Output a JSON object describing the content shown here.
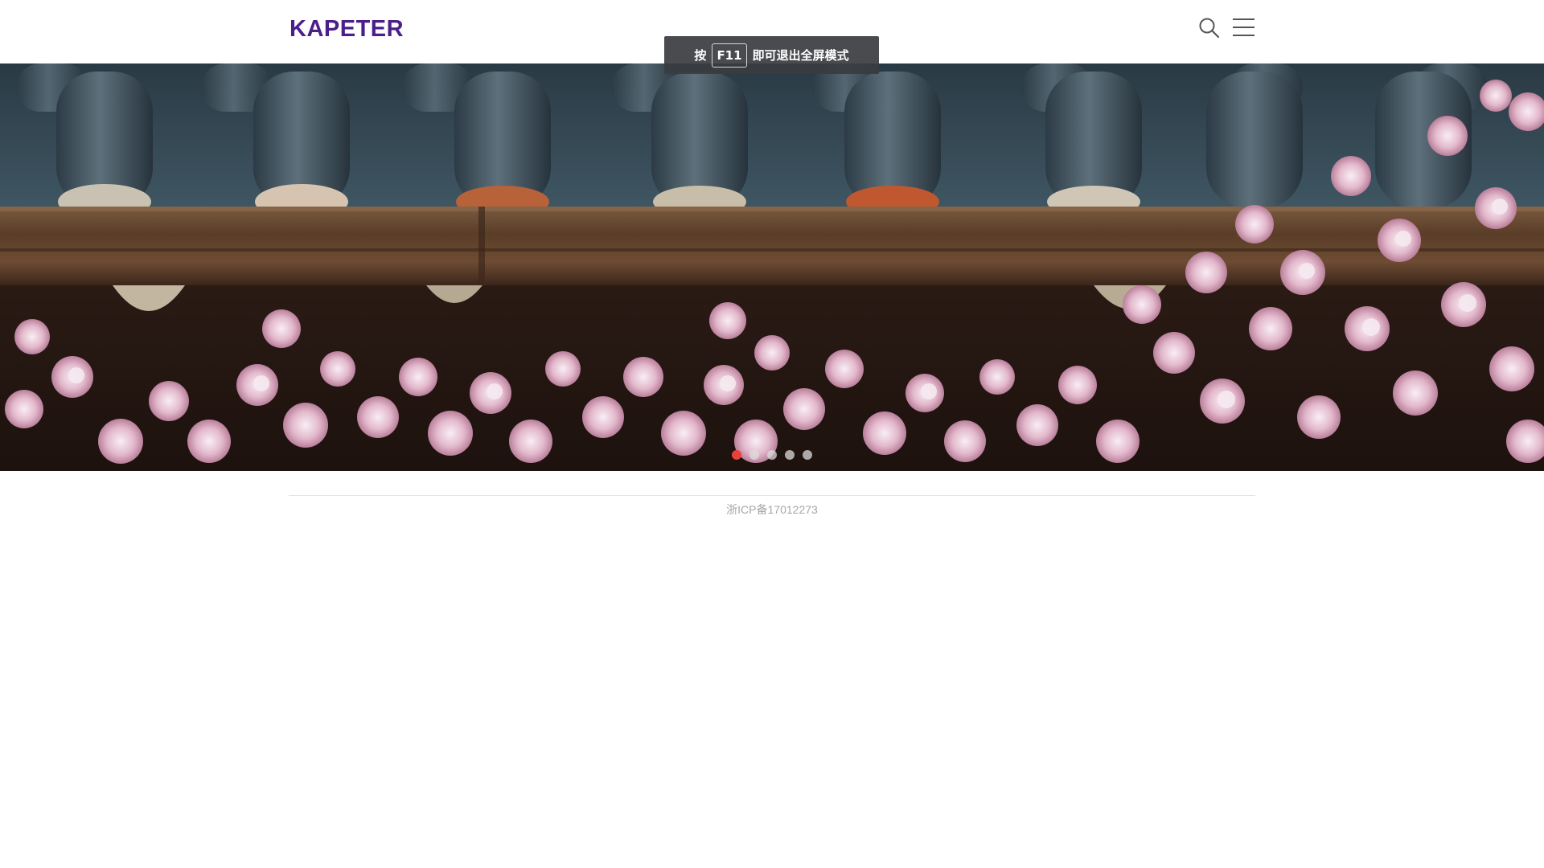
{
  "header": {
    "logo_text": "KAPETER",
    "brand_color": "#4b1e8a",
    "icons": [
      "search-icon",
      "hamburger-menu-icon"
    ]
  },
  "fullscreen_notice": {
    "prefix": "按",
    "key": "F11",
    "suffix": "即可退出全屏模式"
  },
  "banner": {
    "image_subject": "tiled roof eave with cherry blossoms",
    "slide_count": 5,
    "active_slide": 1,
    "active_color": "#e8413c"
  },
  "footer": {
    "icp_text": "浙ICP备17012273"
  }
}
